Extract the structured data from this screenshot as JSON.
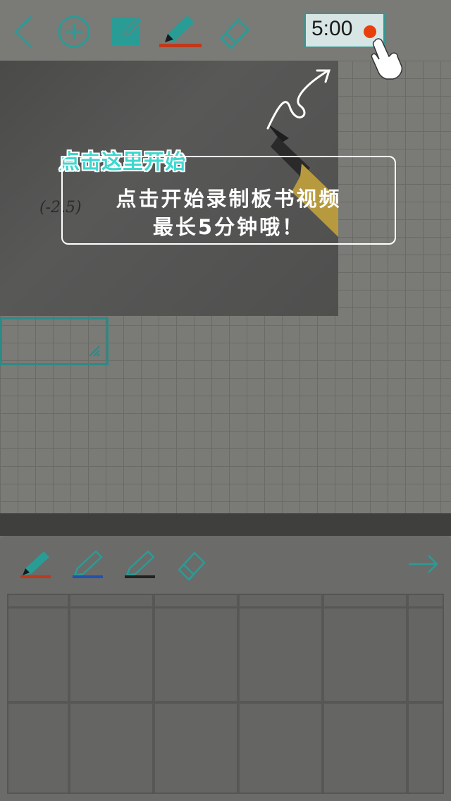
{
  "toolbar": {
    "icons": [
      "back-icon",
      "add-icon",
      "edit-icon",
      "pen-icon",
      "eraser-icon"
    ],
    "timer": "5:00",
    "record_color": "#e8400c",
    "accent": "#2a9c96"
  },
  "photo": {
    "math_text": "(-2.5)"
  },
  "guide": {
    "start_label": "点击这里开始",
    "line1": "点击开始录制板书视频",
    "line2": "最长5分钟哦！"
  },
  "pens": [
    {
      "name": "red-pen",
      "color": "#c0391a"
    },
    {
      "name": "blue-pen",
      "color": "#1f52b3"
    },
    {
      "name": "black-pen",
      "color": "#222222"
    }
  ]
}
